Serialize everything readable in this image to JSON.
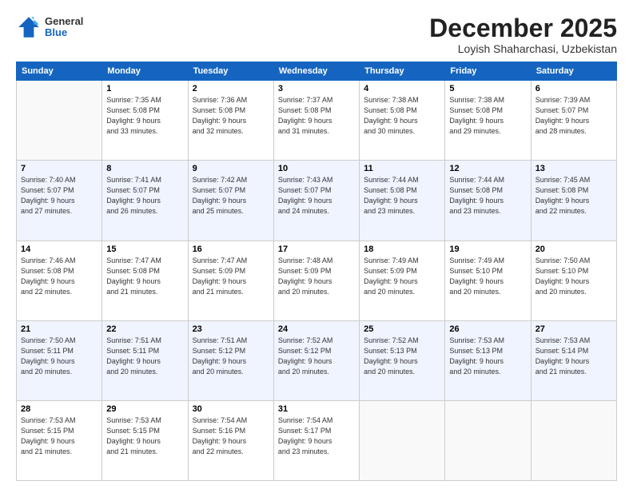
{
  "header": {
    "logo_general": "General",
    "logo_blue": "Blue",
    "month_title": "December 2025",
    "location": "Loyish Shaharchasi, Uzbekistan"
  },
  "days_of_week": [
    "Sunday",
    "Monday",
    "Tuesday",
    "Wednesday",
    "Thursday",
    "Friday",
    "Saturday"
  ],
  "weeks": [
    [
      {
        "day": "",
        "info": ""
      },
      {
        "day": "1",
        "info": "Sunrise: 7:35 AM\nSunset: 5:08 PM\nDaylight: 9 hours\nand 33 minutes."
      },
      {
        "day": "2",
        "info": "Sunrise: 7:36 AM\nSunset: 5:08 PM\nDaylight: 9 hours\nand 32 minutes."
      },
      {
        "day": "3",
        "info": "Sunrise: 7:37 AM\nSunset: 5:08 PM\nDaylight: 9 hours\nand 31 minutes."
      },
      {
        "day": "4",
        "info": "Sunrise: 7:38 AM\nSunset: 5:08 PM\nDaylight: 9 hours\nand 30 minutes."
      },
      {
        "day": "5",
        "info": "Sunrise: 7:38 AM\nSunset: 5:08 PM\nDaylight: 9 hours\nand 29 minutes."
      },
      {
        "day": "6",
        "info": "Sunrise: 7:39 AM\nSunset: 5:07 PM\nDaylight: 9 hours\nand 28 minutes."
      }
    ],
    [
      {
        "day": "7",
        "info": "Sunrise: 7:40 AM\nSunset: 5:07 PM\nDaylight: 9 hours\nand 27 minutes."
      },
      {
        "day": "8",
        "info": "Sunrise: 7:41 AM\nSunset: 5:07 PM\nDaylight: 9 hours\nand 26 minutes."
      },
      {
        "day": "9",
        "info": "Sunrise: 7:42 AM\nSunset: 5:07 PM\nDaylight: 9 hours\nand 25 minutes."
      },
      {
        "day": "10",
        "info": "Sunrise: 7:43 AM\nSunset: 5:07 PM\nDaylight: 9 hours\nand 24 minutes."
      },
      {
        "day": "11",
        "info": "Sunrise: 7:44 AM\nSunset: 5:08 PM\nDaylight: 9 hours\nand 23 minutes."
      },
      {
        "day": "12",
        "info": "Sunrise: 7:44 AM\nSunset: 5:08 PM\nDaylight: 9 hours\nand 23 minutes."
      },
      {
        "day": "13",
        "info": "Sunrise: 7:45 AM\nSunset: 5:08 PM\nDaylight: 9 hours\nand 22 minutes."
      }
    ],
    [
      {
        "day": "14",
        "info": "Sunrise: 7:46 AM\nSunset: 5:08 PM\nDaylight: 9 hours\nand 22 minutes."
      },
      {
        "day": "15",
        "info": "Sunrise: 7:47 AM\nSunset: 5:08 PM\nDaylight: 9 hours\nand 21 minutes."
      },
      {
        "day": "16",
        "info": "Sunrise: 7:47 AM\nSunset: 5:09 PM\nDaylight: 9 hours\nand 21 minutes."
      },
      {
        "day": "17",
        "info": "Sunrise: 7:48 AM\nSunset: 5:09 PM\nDaylight: 9 hours\nand 20 minutes."
      },
      {
        "day": "18",
        "info": "Sunrise: 7:49 AM\nSunset: 5:09 PM\nDaylight: 9 hours\nand 20 minutes."
      },
      {
        "day": "19",
        "info": "Sunrise: 7:49 AM\nSunset: 5:10 PM\nDaylight: 9 hours\nand 20 minutes."
      },
      {
        "day": "20",
        "info": "Sunrise: 7:50 AM\nSunset: 5:10 PM\nDaylight: 9 hours\nand 20 minutes."
      }
    ],
    [
      {
        "day": "21",
        "info": "Sunrise: 7:50 AM\nSunset: 5:11 PM\nDaylight: 9 hours\nand 20 minutes."
      },
      {
        "day": "22",
        "info": "Sunrise: 7:51 AM\nSunset: 5:11 PM\nDaylight: 9 hours\nand 20 minutes."
      },
      {
        "day": "23",
        "info": "Sunrise: 7:51 AM\nSunset: 5:12 PM\nDaylight: 9 hours\nand 20 minutes."
      },
      {
        "day": "24",
        "info": "Sunrise: 7:52 AM\nSunset: 5:12 PM\nDaylight: 9 hours\nand 20 minutes."
      },
      {
        "day": "25",
        "info": "Sunrise: 7:52 AM\nSunset: 5:13 PM\nDaylight: 9 hours\nand 20 minutes."
      },
      {
        "day": "26",
        "info": "Sunrise: 7:53 AM\nSunset: 5:13 PM\nDaylight: 9 hours\nand 20 minutes."
      },
      {
        "day": "27",
        "info": "Sunrise: 7:53 AM\nSunset: 5:14 PM\nDaylight: 9 hours\nand 21 minutes."
      }
    ],
    [
      {
        "day": "28",
        "info": "Sunrise: 7:53 AM\nSunset: 5:15 PM\nDaylight: 9 hours\nand 21 minutes."
      },
      {
        "day": "29",
        "info": "Sunrise: 7:53 AM\nSunset: 5:15 PM\nDaylight: 9 hours\nand 21 minutes."
      },
      {
        "day": "30",
        "info": "Sunrise: 7:54 AM\nSunset: 5:16 PM\nDaylight: 9 hours\nand 22 minutes."
      },
      {
        "day": "31",
        "info": "Sunrise: 7:54 AM\nSunset: 5:17 PM\nDaylight: 9 hours\nand 23 minutes."
      },
      {
        "day": "",
        "info": ""
      },
      {
        "day": "",
        "info": ""
      },
      {
        "day": "",
        "info": ""
      }
    ]
  ]
}
